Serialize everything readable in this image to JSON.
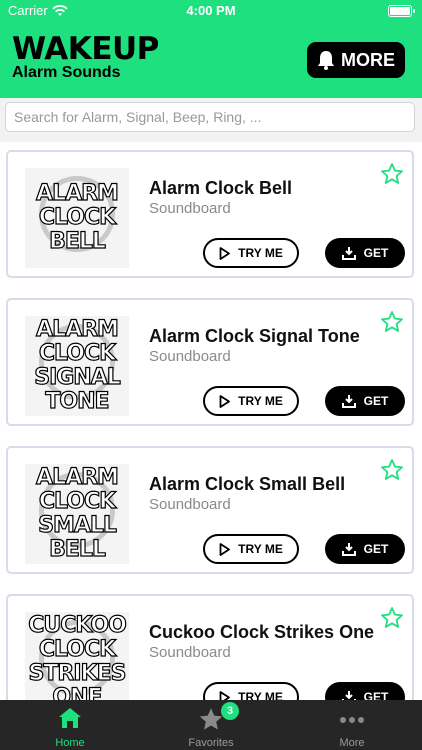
{
  "status_bar": {
    "carrier": "Carrier",
    "time": "4:00 PM"
  },
  "header": {
    "title": "WAKEUP",
    "subtitle": "Alarm Sounds",
    "more_label": "MORE"
  },
  "search": {
    "placeholder": "Search for Alarm, Signal, Beep, Ring, ..."
  },
  "items": [
    {
      "title": "Alarm Clock Bell",
      "subtitle": "Soundboard",
      "thumb_words": [
        "ALARM",
        "CLOCK",
        "BELL"
      ],
      "try_label": "TRY ME",
      "get_label": "GET"
    },
    {
      "title": "Alarm Clock Signal Tone",
      "subtitle": "Soundboard",
      "thumb_words": [
        "ALARM",
        "CLOCK",
        "SIGNAL",
        "TONE"
      ],
      "try_label": "TRY ME",
      "get_label": "GET"
    },
    {
      "title": "Alarm Clock Small Bell",
      "subtitle": "Soundboard",
      "thumb_words": [
        "ALARM",
        "CLOCK",
        "SMALL",
        "BELL"
      ],
      "try_label": "TRY ME",
      "get_label": "GET"
    },
    {
      "title": "Cuckoo Clock Strikes One",
      "subtitle": "Soundboard",
      "thumb_words": [
        "CUCKOO",
        "CLOCK",
        "STRIKES",
        "ONE"
      ],
      "try_label": "TRY ME",
      "get_label": "GET"
    }
  ],
  "tabs": [
    {
      "label": "Home",
      "icon": "home-icon",
      "active": true
    },
    {
      "label": "Favorites",
      "icon": "star-icon",
      "badge": "3"
    },
    {
      "label": "More",
      "icon": "more-dots-icon"
    }
  ],
  "colors": {
    "accent": "#1ee07f",
    "tabbar": "#262626",
    "button_dark": "#000000"
  }
}
